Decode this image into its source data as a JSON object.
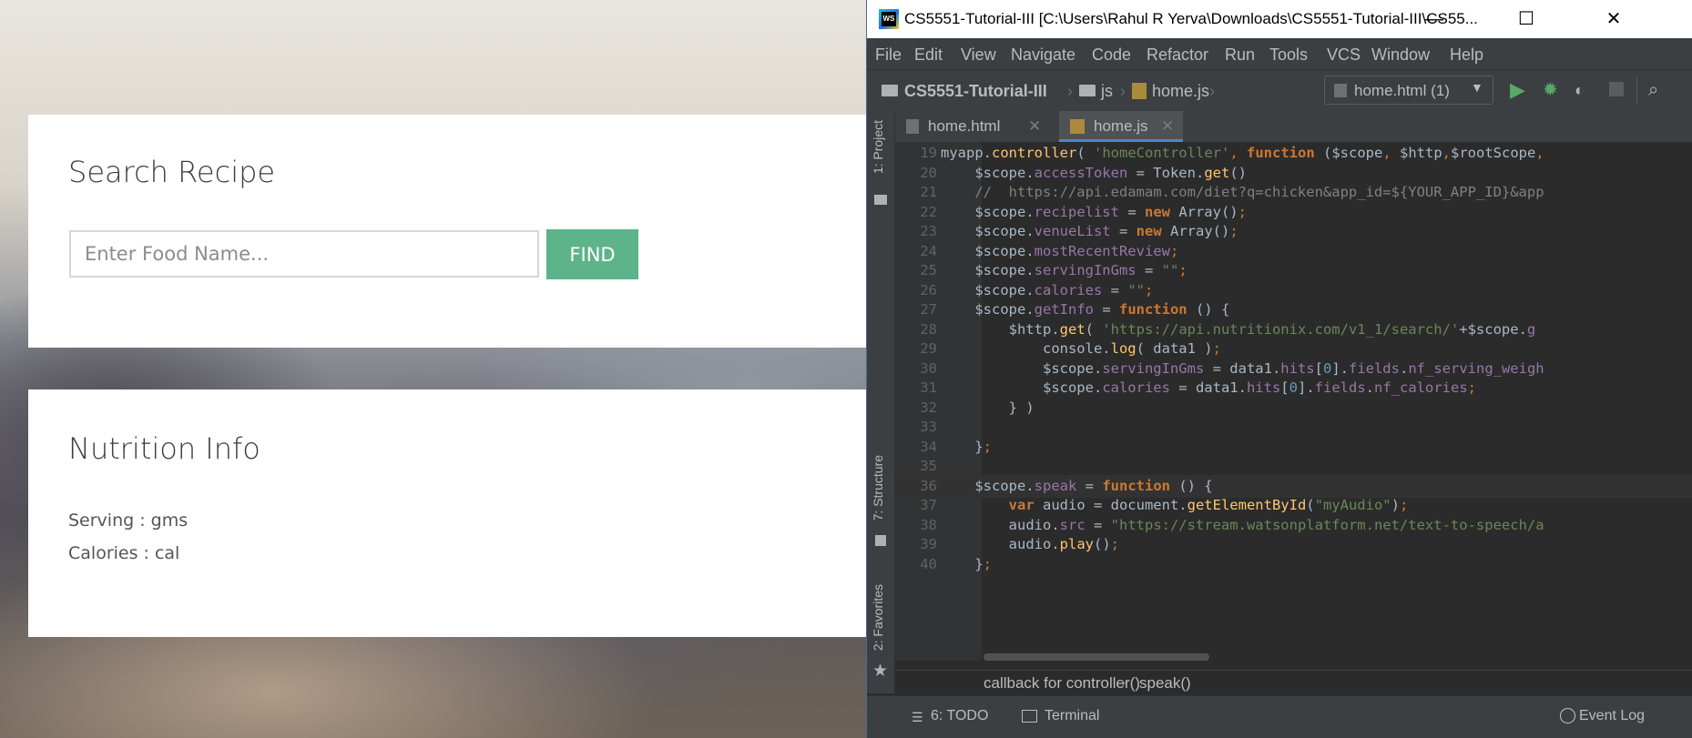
{
  "webpage": {
    "search_card": {
      "title": "Search Recipe",
      "input_placeholder": "Enter Food Name...",
      "find_label": "FIND"
    },
    "nutrition_card": {
      "title": "Nutrition Info",
      "serving_text": "Serving : gms",
      "calories_text": "Calories : cal"
    }
  },
  "ide": {
    "window_title": "CS5551-Tutorial-III [C:\\Users\\Rahul R Yerva\\Downloads\\CS5551-Tutorial-III\\CS55...",
    "logo_text": "WS",
    "window_controls": {
      "minimize": "—",
      "maximize": "☐",
      "close": "✕"
    },
    "menu": [
      "File",
      "Edit",
      "View",
      "Navigate",
      "Code",
      "Refactor",
      "Run",
      "Tools",
      "VCS",
      "Window",
      "Help"
    ],
    "breadcrumbs": {
      "project": "CS5551-Tutorial-III",
      "folder": "js",
      "file": "home.js"
    },
    "run_config": "home.html (1)",
    "side_panels": {
      "project": "1: Project",
      "structure": "7: Structure",
      "favorites": "2: Favorites"
    },
    "tabs": [
      {
        "label": "home.html",
        "icon": "html-file-icon",
        "active": false
      },
      {
        "label": "home.js",
        "icon": "js-file-icon",
        "active": true
      }
    ],
    "code_lines": [
      {
        "num": "19",
        "text": "myapp.controller( 'homeController', function ($scope, $http,$rootScope,"
      },
      {
        "num": "20",
        "text": "    $scope.accessToken = Token.get()"
      },
      {
        "num": "21",
        "text": "    //  https://api.edamam.com/diet?q=chicken&app_id=${YOUR_APP_ID}&app"
      },
      {
        "num": "22",
        "text": "    $scope.recipelist = new Array();"
      },
      {
        "num": "23",
        "text": "    $scope.venueList = new Array();"
      },
      {
        "num": "24",
        "text": "    $scope.mostRecentReview;"
      },
      {
        "num": "25",
        "text": "    $scope.servingInGms = \"\";"
      },
      {
        "num": "26",
        "text": "    $scope.calories = \"\";"
      },
      {
        "num": "27",
        "text": "    $scope.getInfo = function () {"
      },
      {
        "num": "28",
        "text": "        $http.get( 'https://api.nutritionix.com/v1_1/search/'+$scope.g"
      },
      {
        "num": "29",
        "text": "            console.log( data1 );"
      },
      {
        "num": "30",
        "text": "            $scope.servingInGms = data1.hits[0].fields.nf_serving_weigh"
      },
      {
        "num": "31",
        "text": "            $scope.calories = data1.hits[0].fields.nf_calories;"
      },
      {
        "num": "32",
        "text": "        } )"
      },
      {
        "num": "33",
        "text": ""
      },
      {
        "num": "34",
        "text": "    };"
      },
      {
        "num": "35",
        "text": ""
      },
      {
        "num": "36",
        "text": "    $scope.speak = function () {"
      },
      {
        "num": "37",
        "text": "        var audio = document.getElementById(\"myAudio\");"
      },
      {
        "num": "38",
        "text": "        audio.src = \"https://stream.watsonplatform.net/text-to-speech/a"
      },
      {
        "num": "39",
        "text": "        audio.play();"
      },
      {
        "num": "40",
        "text": "    };"
      }
    ],
    "code_breadcrumbs": [
      "callback for controller()",
      "speak()"
    ],
    "status": {
      "todo": "6: TODO",
      "terminal": "Terminal",
      "event_log": "Event Log"
    },
    "colors": {
      "editor_bg": "#2b2b2b",
      "keyword": "#cc7832",
      "string": "#6a8759",
      "property": "#9876aa",
      "function": "#ffc66d"
    }
  }
}
